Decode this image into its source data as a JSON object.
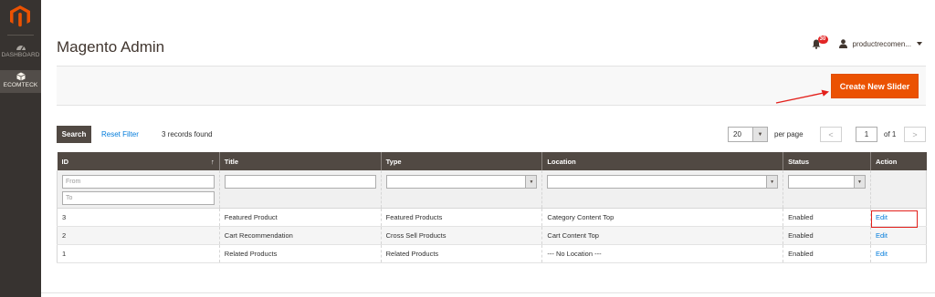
{
  "sidebar": {
    "items": [
      {
        "label": "DASHBOARD",
        "icon": "speedometer-icon"
      },
      {
        "label": "ECOMTECK",
        "icon": "cube-icon"
      }
    ]
  },
  "header": {
    "title": "Magento Admin",
    "notification_count": "30",
    "user_name": "productrecomen..."
  },
  "actions": {
    "create_button": "Create New Slider"
  },
  "toolbar": {
    "search_label": "Search",
    "reset_label": "Reset Filter",
    "records_found": "3 records found",
    "per_page_value": "20",
    "per_page_label": "per page",
    "current_page": "1",
    "of_pages": "of 1",
    "prev_glyph": "<",
    "next_glyph": ">"
  },
  "grid": {
    "columns": [
      "ID",
      "Title",
      "Type",
      "Location",
      "Status",
      "Action"
    ],
    "sort_glyph": "↑",
    "filters": {
      "id_from_placeholder": "From",
      "id_to_placeholder": "To"
    },
    "rows": [
      {
        "id": "3",
        "title": "Featured Product",
        "type": "Featured Products",
        "location": "Category Content Top",
        "status": "Enabled",
        "action": "Edit"
      },
      {
        "id": "2",
        "title": "Cart Recommendation",
        "type": "Cross Sell Products",
        "location": "Cart Content Top",
        "status": "Enabled",
        "action": "Edit"
      },
      {
        "id": "1",
        "title": "Related Products",
        "type": "Related Products",
        "location": "--- No Location ---",
        "status": "Enabled",
        "action": "Edit"
      }
    ]
  },
  "colors": {
    "sidebar": "#373330",
    "primary_button": "#eb5202",
    "grid_header": "#514943",
    "link": "#007bdb",
    "annotation": "#e3201b"
  }
}
